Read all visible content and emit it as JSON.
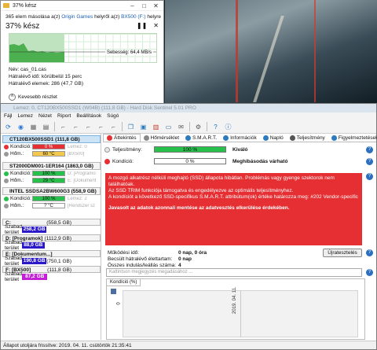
{
  "copy_dialog": {
    "title": "37% kész",
    "source_prefix": "365 elem másolása a(z)",
    "source_name": "Origin Games",
    "source_mid": "helyről a(z)",
    "dest_name": "BX500 (F:)",
    "dest_suffix": "helyre",
    "percent_text": "37% kész",
    "progress": 0.37,
    "speed": "Sebesség: 64,4 MB/s",
    "name_line": "Név: cas_01.cas",
    "remaining_time": "Hátralévő idő: körülbelül 15 perc",
    "remaining_items": "Hátralévő elemek: 286 (47,7 GB)",
    "less_details": "Kevesebb részlet",
    "pause_icon": "pause-icon",
    "close_icon": "close-icon"
  },
  "app": {
    "title": "Lemez: 0, CT120BX500SSD1 (W04B) (111,8 GB) - Hard Disk Sentinel 5.01 PRO",
    "menu": [
      "Fájl",
      "Lemez",
      "Nézet",
      "Riport",
      "Beállítások",
      "Súgó"
    ],
    "disks": [
      {
        "name": "CT120BX500SSD1 (111,8 GB)",
        "kondicio_label": "Kondíció:",
        "kondicio": "0 %",
        "kondicio_color": "#e52f33",
        "kondicio_extra": "Lemez: 0",
        "hom_label": "Hőm.:",
        "hom": "60 °C",
        "hom_color": "#f2c94c",
        "hom_extra": "[BX500]",
        "selected": true
      },
      {
        "name": "ST2000DM001-1ER164 (1863,0 GB)",
        "kondicio_label": "Kondíció:",
        "kondicio": "100 %",
        "kondicio_color": "#27c04a",
        "kondicio_extra": "D: [Programo",
        "hom_label": "Hőm.:",
        "hom": "29 °C",
        "hom_color": "#27c04a",
        "hom_extra": "E: [Dokument",
        "selected": false
      },
      {
        "name": "INTEL SSDSA2BW600G3 (558,9 GB)",
        "kondicio_label": "Kondíció:",
        "kondicio": "100 %",
        "kondicio_color": "#27c04a",
        "kondicio_extra": "Lemez: 2",
        "hom_label": "Hőm.:",
        "hom": "? °C",
        "hom_color": "#ffffff",
        "hom_extra": "[Rendszer sz",
        "selected": false
      }
    ],
    "volumes": [
      {
        "name": "C:",
        "size": "(558,5 GB)",
        "free_label": "Szabad terület",
        "free": "258,2 GB",
        "free_color": "#2a18c9"
      },
      {
        "name": "D: [Programok]",
        "size": "(1112,9 GB)",
        "free_label": "Szabad terület",
        "free": "88,0 GB",
        "free_color": "#2a18c9"
      },
      {
        "name": "E: [Dokumentum...]",
        "size": "(750,1 GB)",
        "free_label": "Szabad terület",
        "free": "190,8 GB",
        "free_color": "#2a18c9"
      },
      {
        "name": "F: [BX500]",
        "size": "(111,8 GB)",
        "free_label": "Szabad terület",
        "free": "87,2 GB",
        "free_color": "#c21fd6"
      }
    ],
    "tabs": [
      "Áttekintés",
      "Hőmérséklet",
      "S.M.A.R.T.",
      "Információk",
      "Napló",
      "Teljesítmény",
      "Figyelmeztetések"
    ],
    "teljesitmeny_label": "Teljesítmény:",
    "teljesitmeny_value": "100 %",
    "teljesitmeny_status": "Kiváló",
    "kondicio_label": "Kondíció:",
    "kondicio_value": "0 %",
    "kondicio_status": "Meghibásodás várható",
    "alert_lines": [
      "A mozgó alkatrész nélküli meghajtó (SSD) állapota hibátlan. Problémás vagy gyenge szektorok nem találhatóak.",
      "Az SSD TRIM funkciója támogatva és engedélyezve az optimális teljesítményhez.",
      "A kondíciót a következő SSD-specifikus S.M.A.R.T. attribútum(ok) értéke határozza meg:  #202 Vendor-specific"
    ],
    "alert_bold": "Javasolt az adatok azonnali mentése az adatvesztés elkerülése érdekében.",
    "mukodesi_label": "Működési idő:",
    "mukodesi_value": "0 nap, 0 óra",
    "becsult_label": "Becsült hátralévő élettartam:",
    "becsult_value": "0 nap",
    "inditas_label": "Összes indulás/leállás száma:",
    "inditas_value": "4",
    "refresh_label": "Újratesztelés",
    "comment_placeholder": "Kattintson megjegyzés megadásához ...",
    "chart_tab_label": "Kondíció  (%)",
    "status_text": "Állapot utoljára frissítve: 2019. 04. 11. csütörtök 21:35:41"
  },
  "chart_data": {
    "type": "line",
    "title": "",
    "ylabel": "",
    "x": [
      "2019. 04. 11."
    ],
    "series": [
      {
        "name": "Kondíció (%)",
        "values": [
          0
        ]
      }
    ],
    "y_tick_labels": [
      "0"
    ]
  }
}
